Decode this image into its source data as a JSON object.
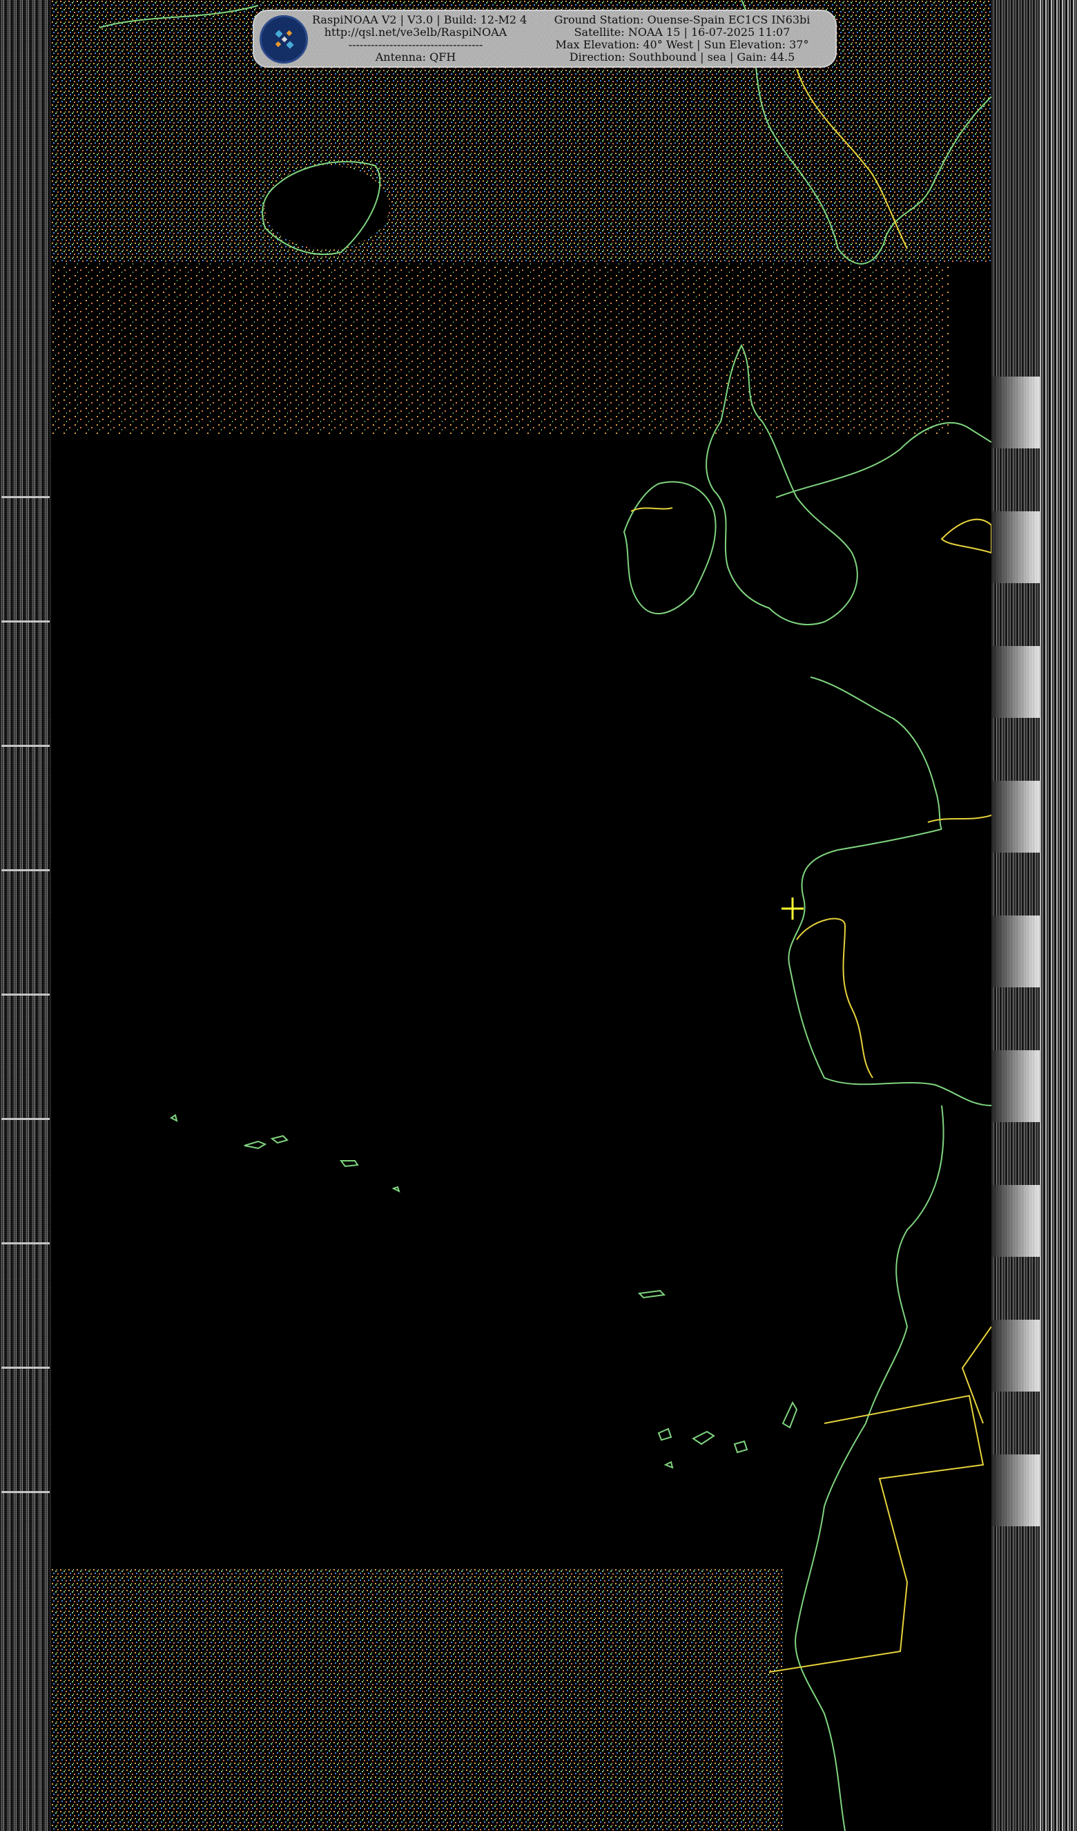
{
  "header": {
    "left_lines": [
      "RaspiNOAA V2 | V3.0 | Build: 12-M2 4",
      "http://qsl.net/ve3elb/RaspiNOAA",
      "------------------------------------",
      "Antenna: QFH"
    ],
    "right_lines": [
      "Ground Station: Ouense-Spain EC1CS IN63bi",
      "Satellite: NOAA 15 | 16-07-2025 11:07",
      "Max Elevation: 40° West | Sun Elevation: 37°",
      "Direction: Southbound | sea | Gain: 44.5"
    ]
  },
  "logo_icon": "satellite-icon",
  "colors": {
    "coastline": "#7fd47f",
    "borders": "#e6d23a",
    "ground_station_marker": "#ffff33",
    "background": "#000000",
    "header_bg": "#b9b9b9"
  }
}
